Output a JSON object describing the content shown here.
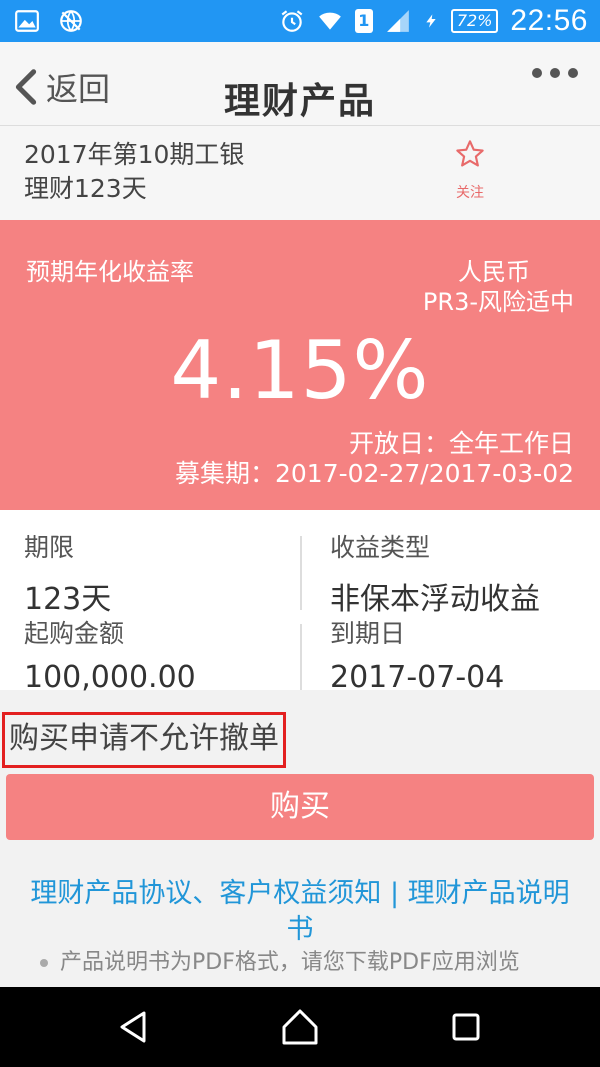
{
  "statusbar": {
    "battery": "72%",
    "sim": "1",
    "time": "22:56"
  },
  "header": {
    "back_label": "返回",
    "title": "理财产品"
  },
  "product": {
    "name_line1": "2017年第10期工银",
    "name_line2": "理财123天",
    "follow_label": "关注"
  },
  "yield_card": {
    "label": "预期年化收益率",
    "currency": "人民币",
    "risk_level": "PR3-风险适中",
    "rate": "4.15%",
    "open_day": "开放日：全年工作日",
    "raise_period": "募集期：2017-02-27/2017-03-02"
  },
  "info": {
    "term_label": "期限",
    "term_value": "123天",
    "income_type_label": "收益类型",
    "income_type_value": "非保本浮动收益",
    "min_amount_label": "起购金额",
    "min_amount_value": "100,000.00",
    "maturity_label": "到期日",
    "maturity_value": "2017-07-04"
  },
  "notice": "购买申请不允许撤单",
  "buy_label": "购买",
  "links": {
    "text": "理财产品协议、客户权益须知 | 理财产品说明书"
  },
  "note": "产品说明书为PDF格式，请您下载PDF应用浏览",
  "colors": {
    "statusbar": "#2196f3",
    "accent_red": "#f58282",
    "link_blue": "#2196d8",
    "highlight_border": "#e32020"
  }
}
